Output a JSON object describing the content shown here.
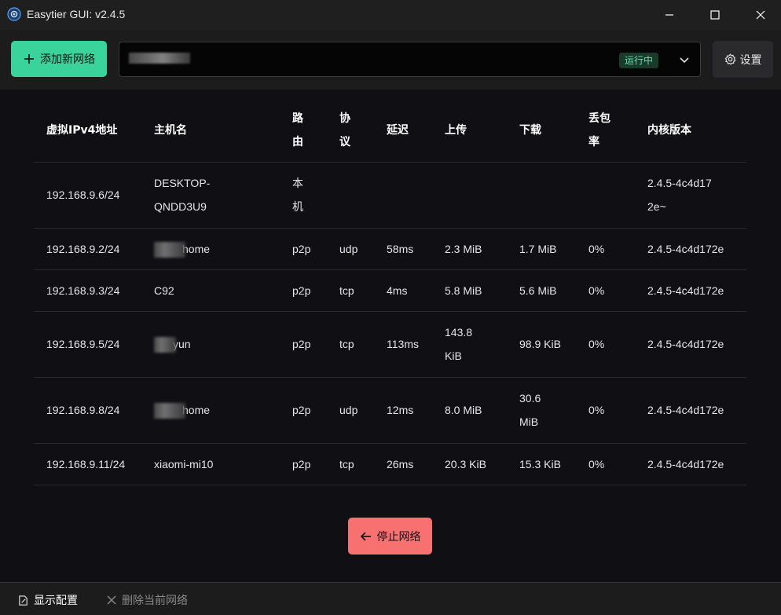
{
  "window": {
    "title": "Easytier GUI: v2.4.5"
  },
  "toolbar": {
    "add_network_label": "添加新网络",
    "status_badge": "运行中",
    "settings_label": "设置"
  },
  "table": {
    "headers": [
      "虚拟IPv4地址",
      "主机名",
      "路由",
      "协议",
      "延迟",
      "上传",
      "下载",
      "丢包率",
      "内核版本"
    ],
    "rows": [
      {
        "ip": "192.168.9.6/24",
        "host": "DESKTOP-QNDD3U9",
        "route": "本机",
        "proto": "",
        "latency": "",
        "up": "",
        "down": "",
        "loss": "",
        "version": "2.4.5-4c4d172e~"
      },
      {
        "ip": "192.168.9.2/24",
        "host": "home",
        "route": "p2p",
        "proto": "udp",
        "latency": "58ms",
        "up": "2.3 MiB",
        "down": "1.7 MiB",
        "loss": "0%",
        "version": "2.4.5-4c4d172e"
      },
      {
        "ip": "192.168.9.3/24",
        "host": "C92",
        "route": "p2p",
        "proto": "tcp",
        "latency": "4ms",
        "up": "5.8 MiB",
        "down": "5.6 MiB",
        "loss": "0%",
        "version": "2.4.5-4c4d172e"
      },
      {
        "ip": "192.168.9.5/24",
        "host": "yun",
        "route": "p2p",
        "proto": "tcp",
        "latency": "113ms",
        "up": "143.8 KiB",
        "down": "98.9 KiB",
        "loss": "0%",
        "version": "2.4.5-4c4d172e"
      },
      {
        "ip": "192.168.9.8/24",
        "host": "home",
        "route": "p2p",
        "proto": "udp",
        "latency": "12ms",
        "up": "8.0 MiB",
        "down": "30.6 MiB",
        "loss": "0%",
        "version": "2.4.5-4c4d172e"
      },
      {
        "ip": "192.168.9.11/24",
        "host": "xiaomi-mi10",
        "route": "p2p",
        "proto": "tcp",
        "latency": "26ms",
        "up": "20.3 KiB",
        "down": "15.3 KiB",
        "loss": "0%",
        "version": "2.4.5-4c4d172e"
      }
    ]
  },
  "actions": {
    "stop_label": "停止网络"
  },
  "footer": {
    "show_config_label": "显示配置",
    "delete_network_label": "删除当前网络"
  },
  "colors": {
    "accent": "#3bd39c",
    "danger": "#f77170",
    "running": "#63e2b7"
  }
}
